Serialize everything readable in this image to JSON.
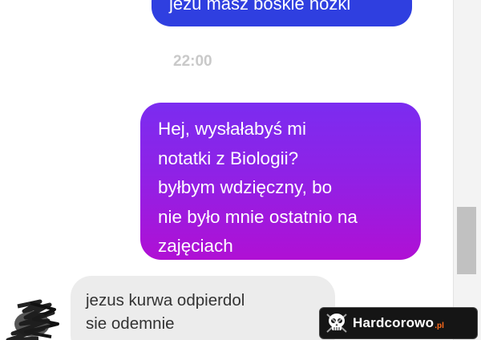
{
  "messages": {
    "top_outgoing": "jezu masz boskie nóżki",
    "timestamp": "22:00",
    "main_outgoing": [
      "Hej, wysłałabyś mi",
      "notatki z Biologii?",
      "byłbym wdzięczny, bo",
      "nie było mnie ostatnio na",
      "zajęciach"
    ],
    "incoming": [
      "jezus kurwa odpierdol",
      "sie odemnie"
    ]
  },
  "watermark": {
    "name": "Hardcorowo",
    "tld": ".pl"
  },
  "colors": {
    "top_bubble": "#2f3fe0",
    "main_bubble_start": "#7b2cf0",
    "main_bubble_end": "#b010d4",
    "incoming_bubble": "#ececec",
    "timestamp": "#c9c9c9"
  },
  "icons": {
    "avatar": "scribbled-avatar",
    "watermark_logo": "skull-icon"
  }
}
